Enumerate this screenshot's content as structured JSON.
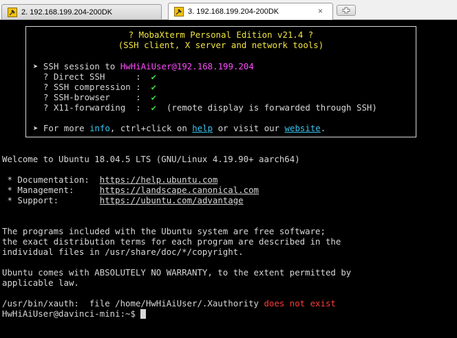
{
  "tabs": [
    {
      "label": "2. 192.168.199.204-200DK",
      "active": false
    },
    {
      "label": "3. 192.168.199.204-200DK",
      "active": true,
      "close": "×"
    }
  ],
  "banner": {
    "title": "? MobaXterm Personal Edition v21.4 ?",
    "subtitle": "(SSH client, X server and network tools)",
    "session_prefix": "➤ SSH session to ",
    "session_target": "HwHiAiUser@192.168.199.204",
    "features": [
      {
        "label": "  ? Direct SSH      :  ",
        "check": "✔",
        "note": ""
      },
      {
        "label": "  ? SSH compression :  ",
        "check": "✔",
        "note": ""
      },
      {
        "label": "  ? SSH-browser     :  ",
        "check": "✔",
        "note": ""
      },
      {
        "label": "  ? X11-forwarding  :  ",
        "check": "✔",
        "note": "  (remote display is forwarded through SSH)"
      }
    ],
    "more_prefix": "➤ For more ",
    "more_info": "info",
    "more_mid": ", ctrl+click on ",
    "more_help": "help",
    "more_or": " or visit our ",
    "more_website": "website",
    "more_end": "."
  },
  "welcome": "Welcome to Ubuntu 18.04.5 LTS (GNU/Linux 4.19.90+ aarch64)",
  "resources": [
    {
      "label": " * Documentation:  ",
      "url": "https://help.ubuntu.com"
    },
    {
      "label": " * Management:     ",
      "url": "https://landscape.canonical.com"
    },
    {
      "label": " * Support:        ",
      "url": "https://ubuntu.com/advantage"
    }
  ],
  "notice": [
    "The programs included with the Ubuntu system are free software;",
    "the exact distribution terms for each program are described in the",
    "individual files in /usr/share/doc/*/copyright."
  ],
  "warranty": [
    "Ubuntu comes with ABSOLUTELY NO WARRANTY, to the extent permitted by",
    "applicable law."
  ],
  "xauth_prefix": "/usr/bin/xauth:  file /home/HwHiAiUser/.Xauthority ",
  "xauth_error": "does not exist",
  "prompt": "HwHiAiUser@davinci-mini:~$ "
}
